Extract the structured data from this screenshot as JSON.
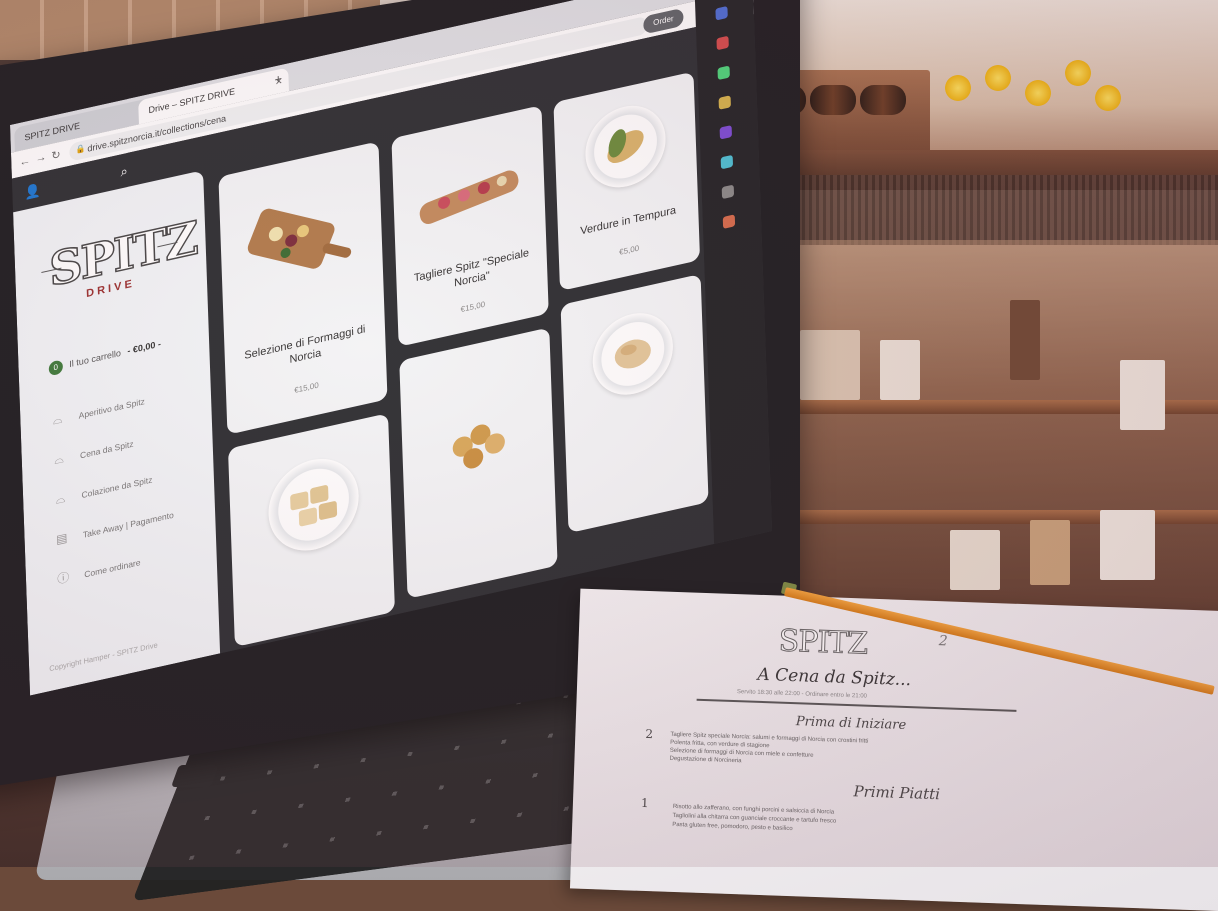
{
  "browser": {
    "tabs": [
      {
        "label": "SPITZ DRIVE",
        "active": false
      },
      {
        "label": "Drive – SPITZ DRIVE",
        "active": true
      }
    ],
    "new_tab": "+",
    "url": "drive.spitznorcia.it/collections/cena",
    "profile_button": "Order"
  },
  "site": {
    "brand": "SPITZ",
    "brand_sub": "DRIVE",
    "cart": {
      "badge": "0",
      "label": "Il tuo carrello",
      "total": "- €0,00 -"
    },
    "menu": [
      {
        "label": "Aperitivo da Spitz",
        "icon": "cloche-icon"
      },
      {
        "label": "Cena da Spitz",
        "icon": "cloche-icon"
      },
      {
        "label": "Colazione da Spitz",
        "icon": "cloche-icon"
      },
      {
        "label": "Take Away | Pagamento",
        "icon": "receipt-icon"
      },
      {
        "label": "Come ordinare",
        "icon": "info-icon"
      }
    ],
    "copyright": "Copyright Hamper - SPITZ Drive"
  },
  "products": [
    {
      "name": "Selezione di Formaggi di Norcia",
      "price": "€15,00"
    },
    {
      "name": "Tagliere Spitz \"Speciale Norcia\"",
      "price": "€15,00"
    },
    {
      "name": "Verdure in Tempura",
      "price": "€5,00"
    },
    {
      "name": "",
      "price": ""
    },
    {
      "name": "",
      "price": ""
    },
    {
      "name": "",
      "price": ""
    }
  ],
  "paper_menu": {
    "logo": "SPITZ",
    "title": "A Cena da Spitz...",
    "subtitle": "Servito 18:30 alle 22:00 - Ordinare entro le 21:00",
    "corner_note": "2",
    "sections": [
      {
        "heading": "Prima di Iniziare",
        "number": "2",
        "lines": [
          "Tagliere Spitz speciale Norcia: salumi e formaggi di Norcia con crostini fritti",
          "Polenta fritta, con verdure di stagione",
          "Selezione di formaggi di Norcia con miele e confetture",
          "Degustazione di Norcineria"
        ]
      },
      {
        "heading": "Primi Piatti",
        "number": "1",
        "lines": [
          "Risotto allo zafferano, con funghi porcini e salsiccia di Norcia",
          "Tagliolini alla chitarra con guanciale croccante e tartufo fresco",
          "Pasta gluten free, pomodoro, pesto e basilico"
        ]
      }
    ]
  },
  "colors": {
    "accent": "#9a2f2f",
    "cart_badge": "#3d7a3a",
    "sidebar_bg": "#f1f4f7",
    "page_bg": "#2b2d31"
  }
}
